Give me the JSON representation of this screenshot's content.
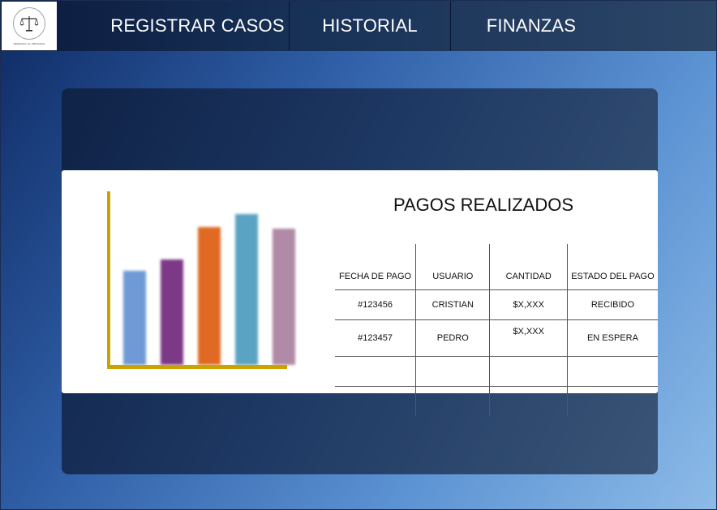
{
  "nav": {
    "items": [
      {
        "label": "REGISTRAR CASOS"
      },
      {
        "label": "HISTORIAL"
      },
      {
        "label": "FINANZAS"
      }
    ]
  },
  "logo": {
    "icon": "scales-of-justice-icon",
    "caption": "DERECHO AL ABOGADO"
  },
  "payments": {
    "title": "PAGOS REALIZADOS",
    "columns": [
      "FECHA DE PAGO",
      "USUARIO",
      "CANTIDAD",
      "ESTADO DEL PAGO"
    ],
    "rows": [
      [
        "#123456",
        "CRISTIAN",
        "$X,XXX",
        "RECIBIDO"
      ],
      [
        "#123457",
        "PEDRO",
        "$X,XXX",
        "EN ESPERA"
      ],
      [
        "",
        "",
        "",
        ""
      ],
      [
        "",
        "",
        "",
        ""
      ]
    ]
  },
  "chart_data": {
    "type": "bar",
    "values": [
      0.58,
      0.65,
      0.85,
      0.93,
      0.84
    ],
    "colors": [
      "#6f9ad6",
      "#7c3a86",
      "#e06a24",
      "#5ba3c2",
      "#b08aa6"
    ],
    "axis_color": "#c8a400"
  }
}
